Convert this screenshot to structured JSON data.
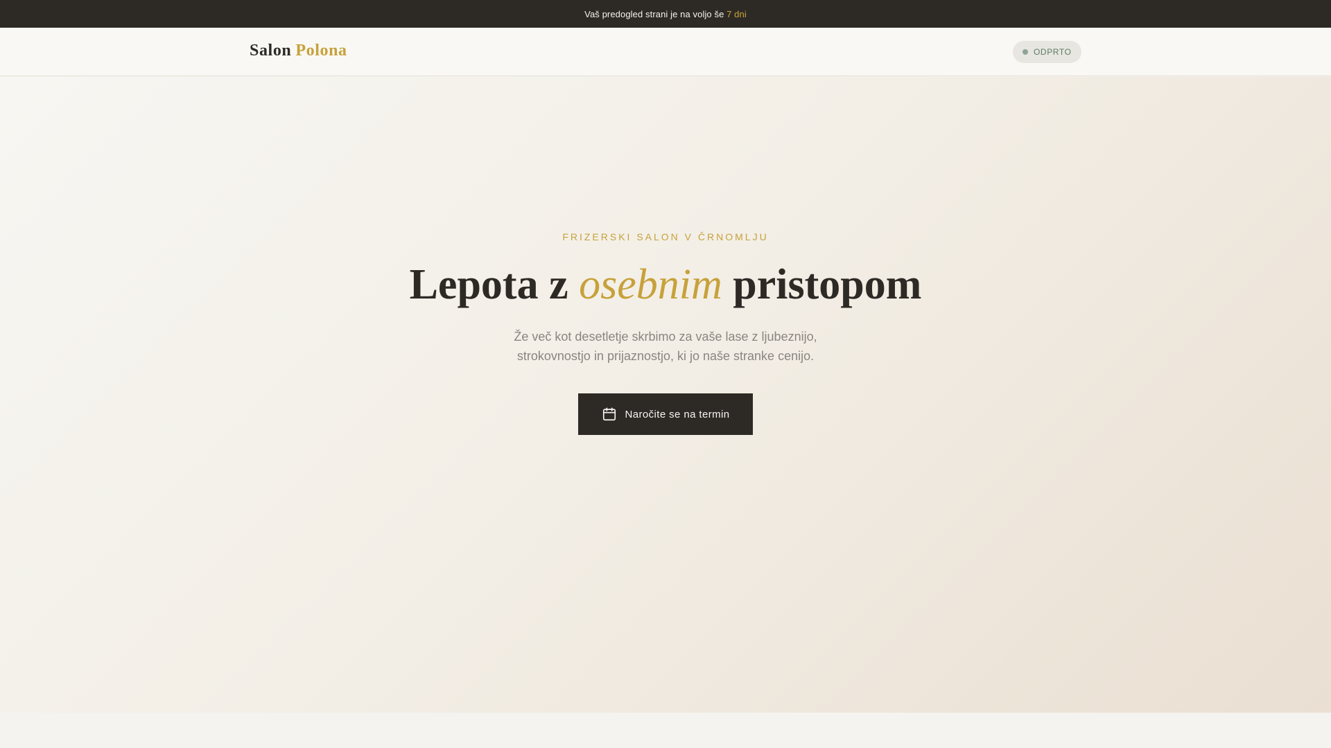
{
  "topbar": {
    "text_before": "Vaš predogled strani je na voljo še",
    "text_accent": "7 dni"
  },
  "header": {
    "brand_first": "Salon",
    "brand_second": "Polona",
    "status_label": "ODPRTO"
  },
  "hero": {
    "kicker": "FRIZERSKI SALON V ČRNOMLJU",
    "headline_before": "Lepota z",
    "headline_emphasis": "osebnim",
    "headline_after": "pristopom",
    "subtitle_line1": "Že več kot desetletje skrbimo za vaše lase z ljubeznijo,",
    "subtitle_line2": "strokovnostjo in prijaznostjo, ki jo naše stranke cenijo.",
    "cta_label": "Naročite se na termin",
    "cta_icon": "calendar-icon"
  },
  "colors": {
    "dark": "#2d2a26",
    "accent_gold": "#c7a13a",
    "status_green": "#5b7a63",
    "muted_text": "#8a8580"
  }
}
